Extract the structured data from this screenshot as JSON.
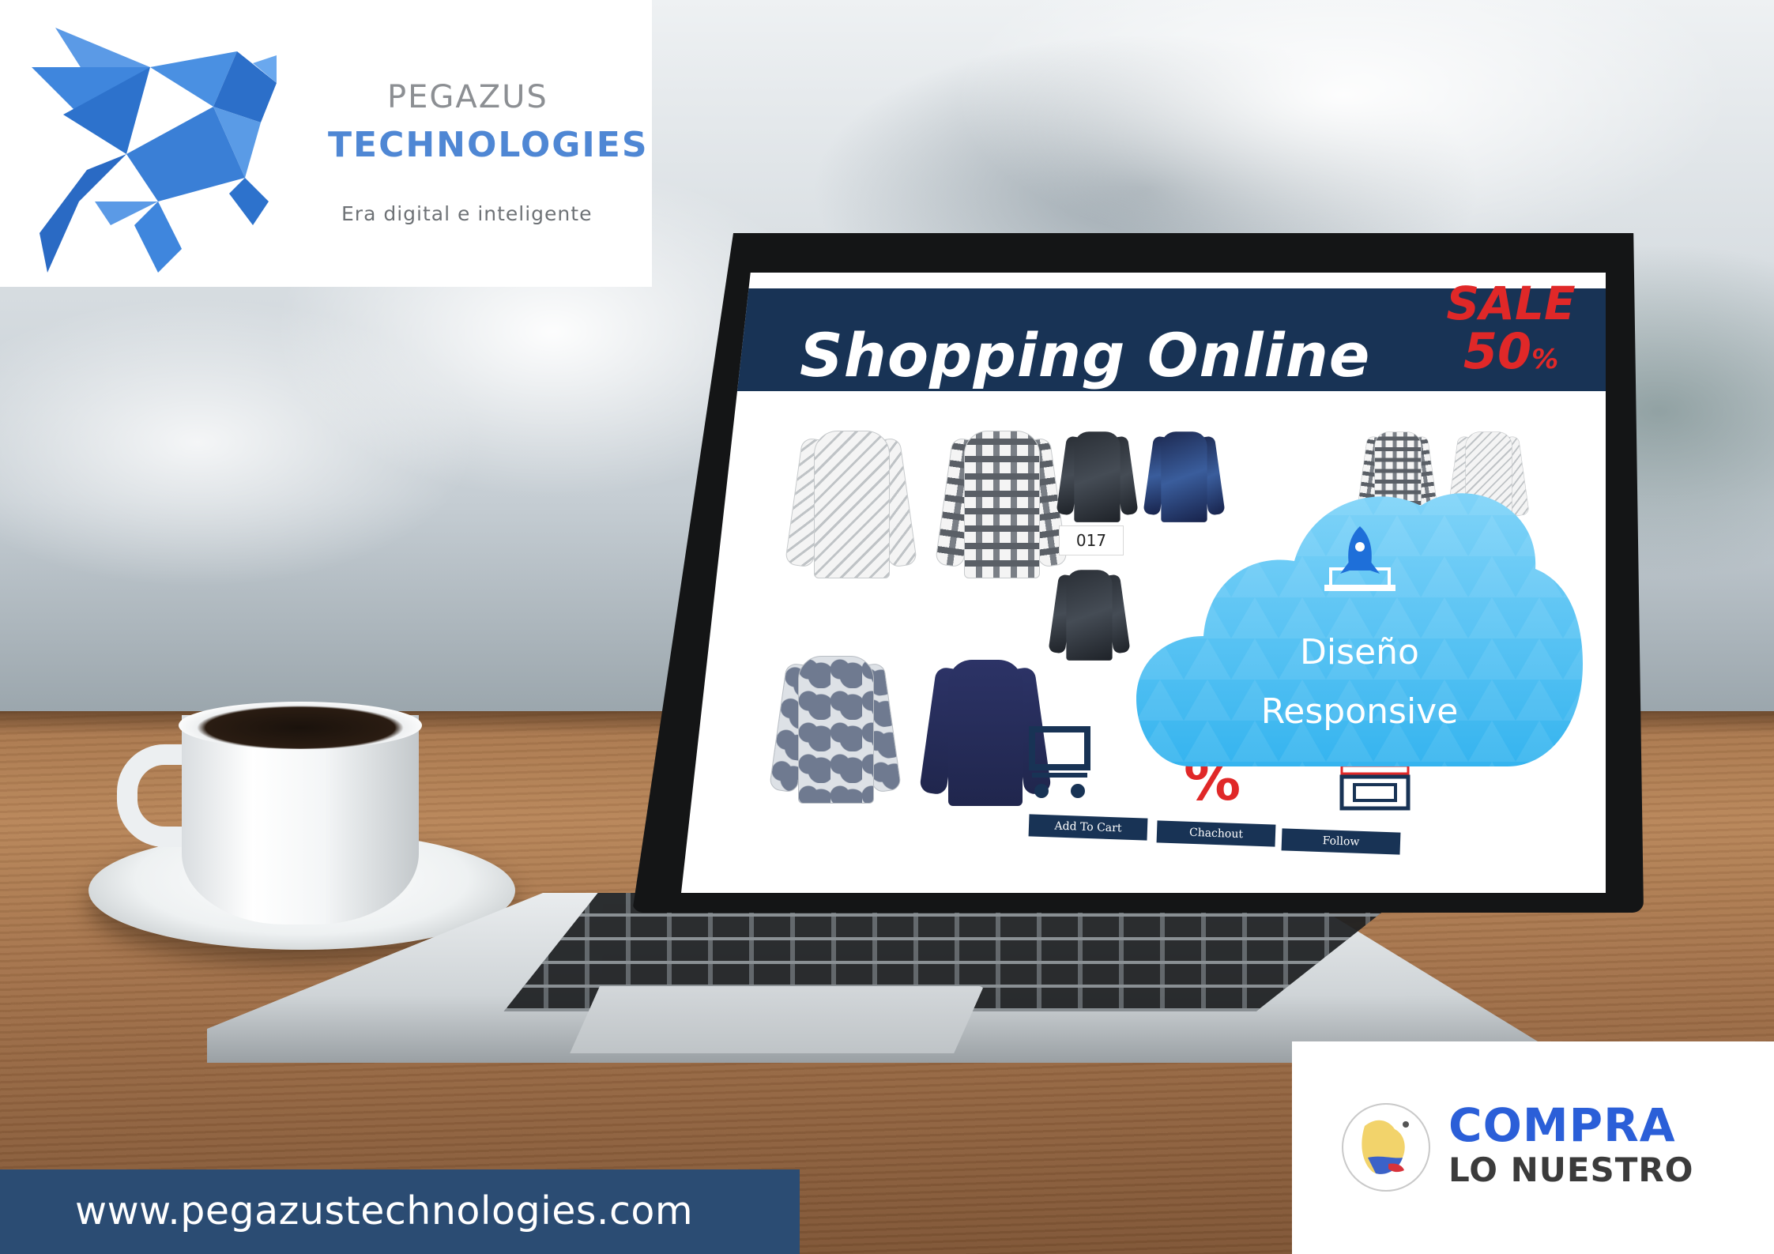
{
  "brand": {
    "name": "PEGAZUS",
    "subtitle": "TECHNOLOGIES",
    "tagline": "Era digital e inteligente",
    "logo_icon": "pegasus-logo-icon",
    "colors": {
      "primary": "#4f87d4",
      "gray": "#8c8f93"
    }
  },
  "screen": {
    "title": "Shopping Online",
    "sale_label": "SALE",
    "sale_value": "50",
    "sale_unit": "%",
    "product_tag": "017",
    "percent_glyph": "%",
    "buttons": {
      "add_to_cart": "Add To Cart",
      "checkout": "Chachout",
      "follow": "Follow"
    },
    "colors": {
      "header": "#183355",
      "sale": "#e02828"
    }
  },
  "cloud": {
    "line1": "Diseño",
    "line2": "Responsive",
    "icon": "rocket-icon",
    "color": "#4fc3f7"
  },
  "footer": {
    "url": "www.pegazustechnologies.com",
    "color": "#2b4c73"
  },
  "campaign": {
    "title": "COMPRA",
    "subtitle": "LO NUESTRO",
    "seal_icon": "colombia-seal-icon",
    "colors": {
      "title": "#2b5fd8",
      "subtitle": "#3b3b3b"
    }
  }
}
